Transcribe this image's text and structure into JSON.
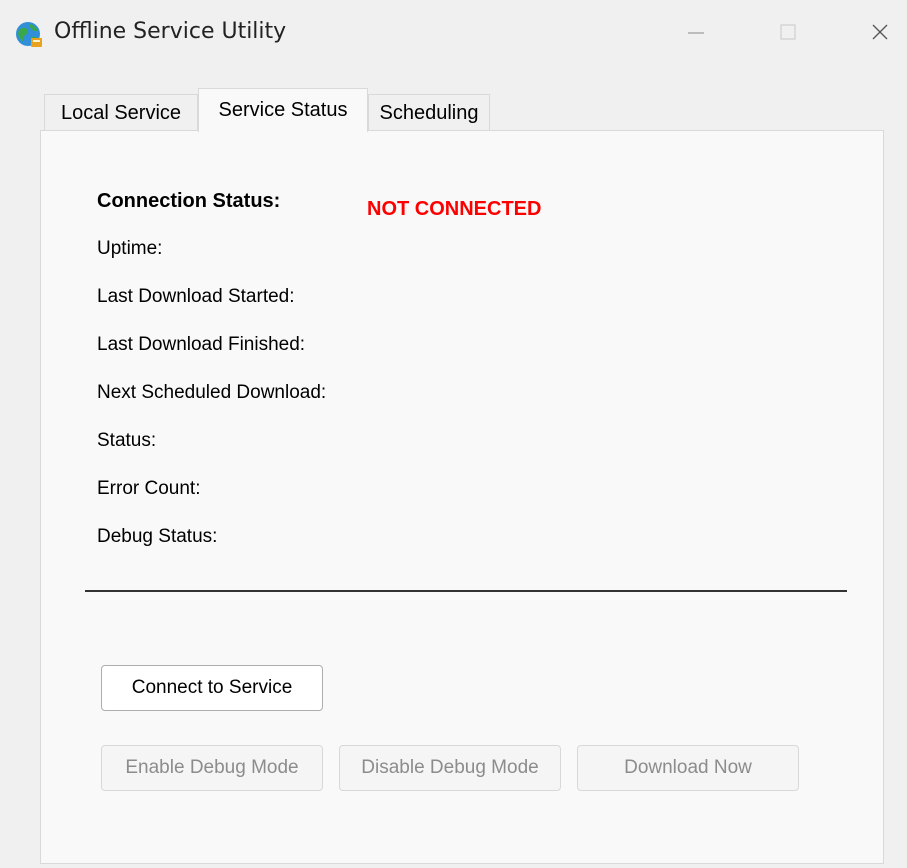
{
  "window": {
    "title": "Offline Service Utility",
    "icon": "globe-app-icon"
  },
  "tabs": [
    {
      "label": "Local Service",
      "active": false
    },
    {
      "label": "Service Status",
      "active": true
    },
    {
      "label": "Scheduling",
      "active": false
    }
  ],
  "status": {
    "connection_label": "Connection Status:",
    "connection_value": "NOT CONNECTED",
    "connection_color": "#ff0000",
    "fields": [
      {
        "label": "Uptime:"
      },
      {
        "label": "Last Download Started:"
      },
      {
        "label": "Last Download Finished:"
      },
      {
        "label": "Next Scheduled Download:"
      },
      {
        "label": "Status:"
      },
      {
        "label": "Error Count:"
      },
      {
        "label": "Debug Status:"
      }
    ]
  },
  "buttons": {
    "connect": "Connect to Service",
    "enable_debug": "Enable Debug Mode",
    "disable_debug": "Disable Debug Mode",
    "download_now": "Download Now"
  }
}
